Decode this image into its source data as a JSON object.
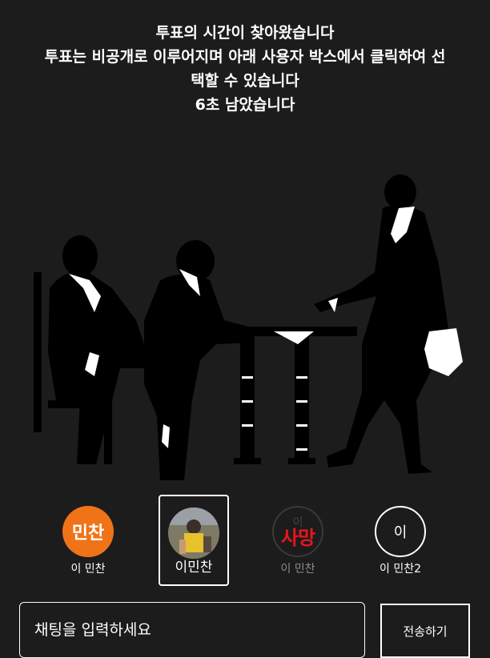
{
  "announcement": {
    "line1": "투표의 시간이 찾아왔습니다",
    "line2": "투표는 비공개로 이루어지며 아래 사용자 박스에서 클릭하여 선",
    "line3": "택할 수 있습니다",
    "countdown": "6초 남았습니다"
  },
  "players": [
    {
      "avatar_text": "민찬",
      "name": "이 민찬",
      "style": "orange"
    },
    {
      "avatar_text": "",
      "name": "이민찬",
      "style": "photo",
      "selected": true
    },
    {
      "avatar_text": "이",
      "dead_label": "사망",
      "name": "이 민찬",
      "style": "dead"
    },
    {
      "avatar_text": "이",
      "name": "이 민찬2",
      "style": "outline"
    }
  ],
  "chat": {
    "placeholder": "채팅을 입력하세요",
    "send_label": "전송하기"
  },
  "colors": {
    "background": "#1c1c1c",
    "orange_avatar": "#f07318",
    "dead_red": "#e8161c"
  }
}
